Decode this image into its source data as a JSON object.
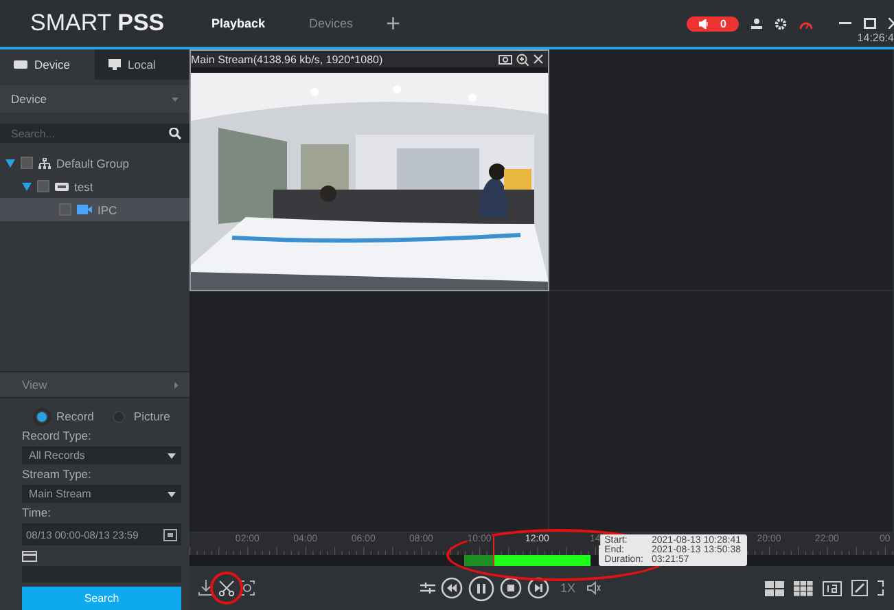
{
  "app": {
    "logo": "SMART **PSS**"
  },
  "tabs": [
    {
      "label": "Playback",
      "selected": true
    },
    {
      "label": "Devices",
      "selected": false
    }
  ],
  "add_tab": "+",
  "alarm": {
    "count": "0"
  },
  "clock": "14:26:4",
  "sidebar": {
    "tabs": [
      {
        "label": "Device",
        "selected": true
      },
      {
        "label": "Local",
        "selected": false
      }
    ],
    "device_select": "Device",
    "search": {
      "placeholder": "Search..."
    },
    "tree": [
      {
        "label": "Default Group",
        "expanded": true,
        "checked": false,
        "selected": false,
        "children": [
          {
            "label": "test",
            "expanded": true,
            "checked": false,
            "selected": false,
            "children": [
              {
                "label": "IPC",
                "checked": false,
                "selected": true
              }
            ]
          }
        ]
      }
    ],
    "view": "View",
    "mode": [
      {
        "label": "Record",
        "selected": true
      },
      {
        "label": "Picture",
        "selected": false
      }
    ],
    "record_type": {
      "label": "Record Type:",
      "value": "All Records"
    },
    "stream_type": {
      "label": "Stream Type:",
      "value": "Main Stream"
    },
    "time": {
      "label": "Time:",
      "value": "08/13 00:00-08/13 23:59"
    },
    "search_button": "Search"
  },
  "player": {
    "pane": {
      "title": "Main Stream(4138.96 kb/s, 1920*1080)",
      "kind": "picture"
    },
    "timeline": {
      "ticks": [
        "02:00",
        "04:00",
        "06:00",
        "08:00",
        "10:00",
        "12:00",
        "14",
        "20:00",
        "22:00",
        "00"
      ],
      "tooltip": [
        {
          "label": "Start:",
          "value": "2021-08-13 10:28:41"
        },
        {
          "label": "End:",
          "value": "2021-08-13 13:50:38"
        },
        {
          "label": "Duration:",
          "value": "03:21:57"
        }
      ]
    },
    "speed": "1X"
  }
}
